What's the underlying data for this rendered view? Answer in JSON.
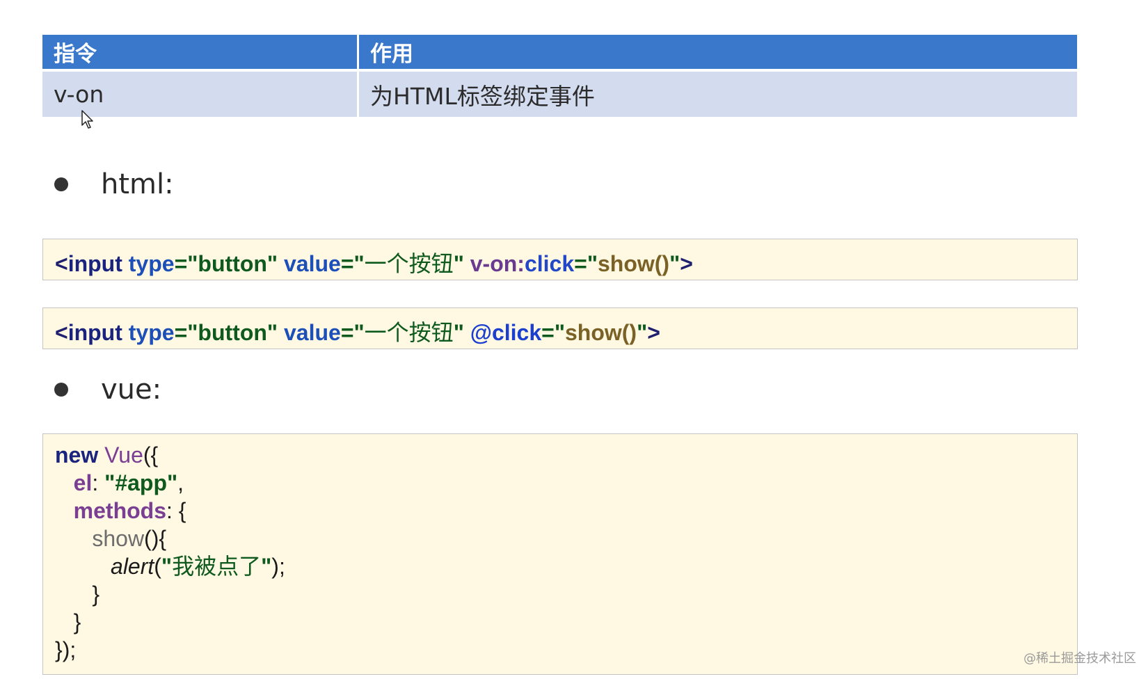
{
  "table": {
    "headers": [
      "指令",
      "作用"
    ],
    "rows": [
      [
        "v-on",
        "为HTML标签绑定事件"
      ]
    ]
  },
  "sections": {
    "html_label": "html:",
    "vue_label": "vue:"
  },
  "code_html_1": {
    "open": "<",
    "tag": "input",
    "type_attr": "type",
    "eq1": "=",
    "type_val": "\"button\"",
    "value_attr": "value",
    "eq2": "=",
    "q_open": "\"",
    "value_text": "一个按钮",
    "q_close": "\"",
    "directive_prefix": "v-on:",
    "event": "click",
    "eq3": "=",
    "q3_open": "\"",
    "handler": "show()",
    "q3_close": "\"",
    "close": ">"
  },
  "code_html_2": {
    "open": "<",
    "tag": "input",
    "type_attr": "type",
    "eq1": "=",
    "type_val": "\"button\"",
    "value_attr": "value",
    "eq2": "=",
    "q_open": "\"",
    "value_text": "一个按钮",
    "q_close": "\"",
    "shorthand": "@click",
    "eq3": "=",
    "q3_open": "\"",
    "handler": "show()",
    "q3_close": "\"",
    "close": ">"
  },
  "code_vue": {
    "l1_new": "new",
    "l1_vue": "Vue",
    "l1_rest": "({",
    "l2_key": "el",
    "l2_colon": ": ",
    "l2_val": "\"#app\"",
    "l2_comma": ",",
    "l3_key": "methods",
    "l3_rest": ": {",
    "l4_fn": "show",
    "l4_rest": "(){",
    "l5_alert": "alert",
    "l5_open": "(",
    "l5_q1": "\"",
    "l5_text": "我被点了",
    "l5_q2": "\"",
    "l5_close": ");",
    "l6": "}",
    "l7": "}",
    "l8": "});"
  },
  "watermark": "@稀土掘金技术社区"
}
